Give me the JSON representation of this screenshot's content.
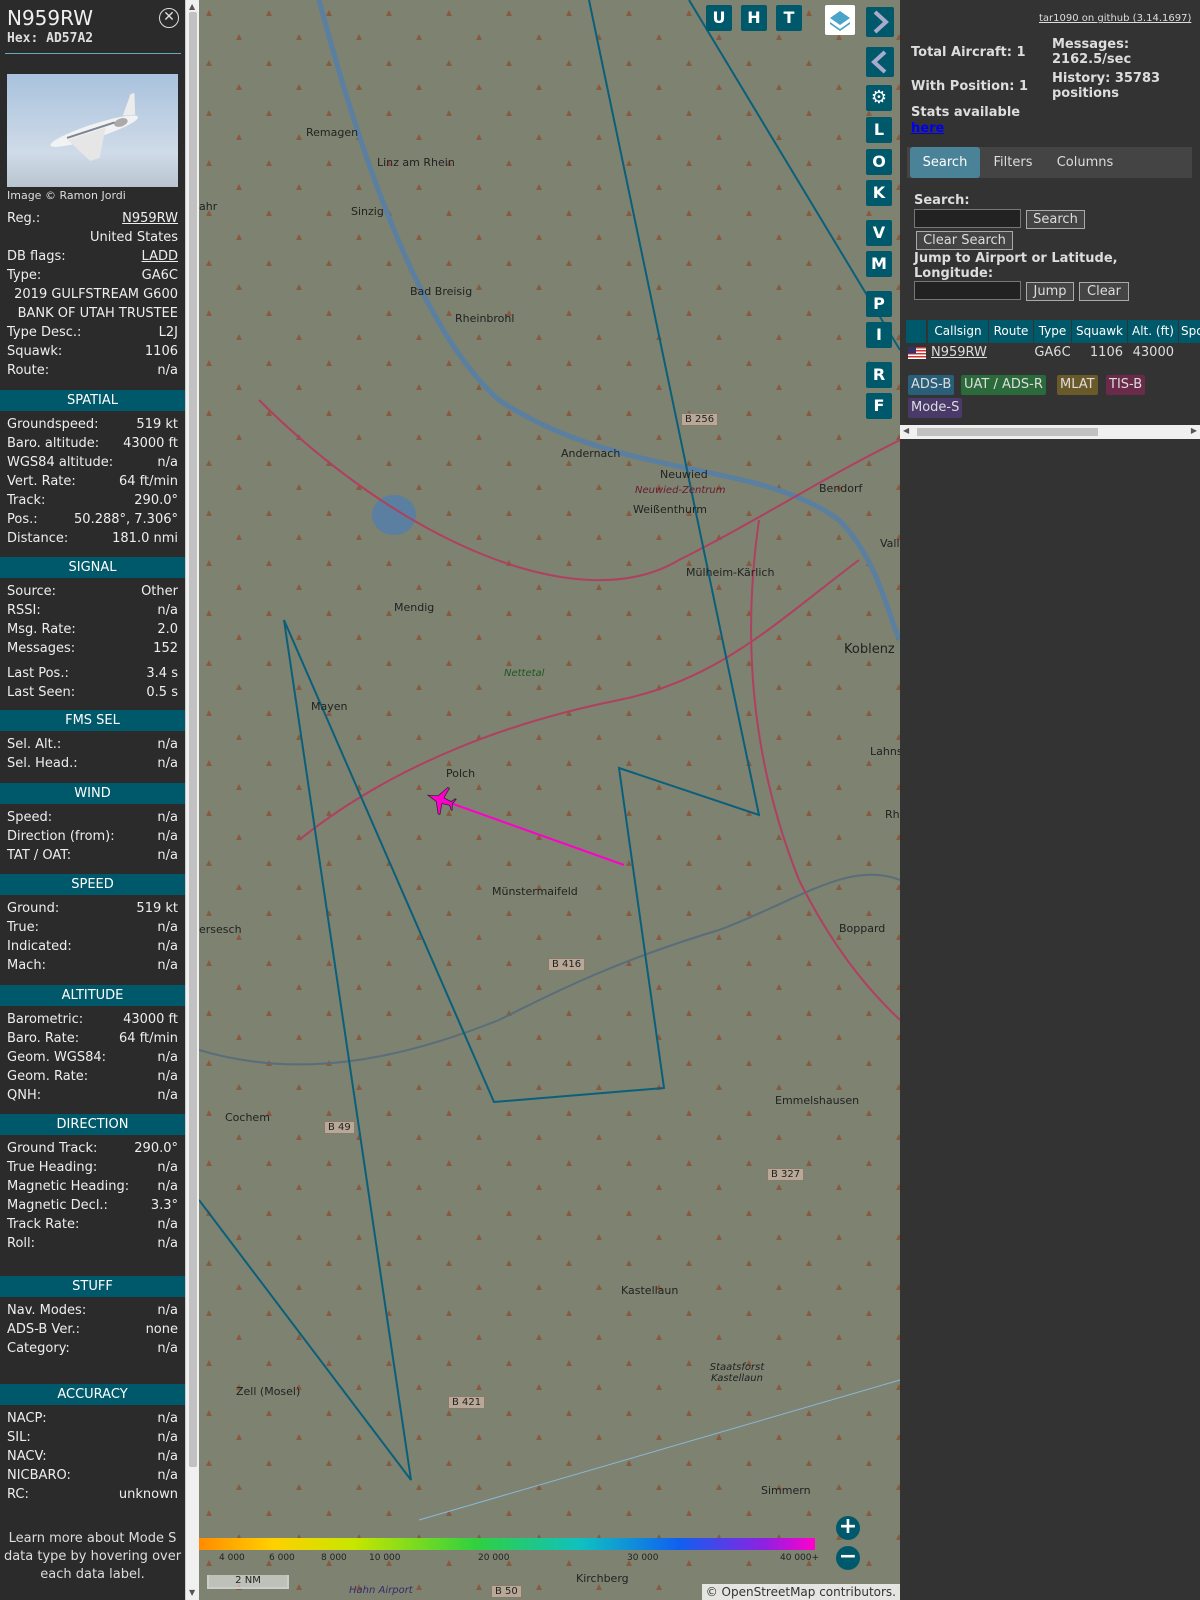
{
  "aircraft": {
    "registration": "N959RW",
    "hex_label": "Hex: AD57A2",
    "image_credit": "Image © Ramon Jordi",
    "details": [
      {
        "label": "Reg.:",
        "value": "N959RW"
      },
      {
        "label": "",
        "value": "United States"
      },
      {
        "label": "DB flags:",
        "value": "LADD"
      },
      {
        "label": "Type:",
        "value": "GA6C"
      },
      {
        "label": "",
        "value": "2019 GULFSTREAM G600"
      },
      {
        "label": "",
        "value": "BANK OF UTAH TRUSTEE"
      },
      {
        "label": "Type Desc.:",
        "value": "L2J"
      },
      {
        "label": "Squawk:",
        "value": "1106"
      },
      {
        "label": "Route:",
        "value": "n/a"
      }
    ],
    "sections": [
      {
        "title": "SPATIAL",
        "rows": [
          {
            "label": "Groundspeed:",
            "value": "519 kt"
          },
          {
            "label": "Baro. altitude:",
            "value": "43000 ft"
          },
          {
            "label": "WGS84 altitude:",
            "value": "n/a"
          },
          {
            "label": "Vert. Rate:",
            "value": "64 ft/min"
          },
          {
            "label": "Track:",
            "value": "290.0°"
          },
          {
            "label": "Pos.:",
            "value": "50.288°, 7.306°"
          },
          {
            "label": "Distance:",
            "value": "181.0 nmi"
          }
        ]
      },
      {
        "title": "SIGNAL",
        "rows": [
          {
            "label": "Source:",
            "value": "Other"
          },
          {
            "label": "RSSI:",
            "value": "n/a"
          },
          {
            "label": "Msg. Rate:",
            "value": "2.0"
          },
          {
            "label": "Messages:",
            "value": "152"
          },
          {
            "label": "Last Pos.:",
            "value": "3.4 s"
          },
          {
            "label": "Last Seen:",
            "value": "0.5 s"
          }
        ]
      },
      {
        "title": "FMS SEL",
        "rows": [
          {
            "label": "Sel. Alt.:",
            "value": "n/a"
          },
          {
            "label": "Sel. Head.:",
            "value": "n/a"
          }
        ]
      },
      {
        "title": "WIND",
        "rows": [
          {
            "label": "Speed:",
            "value": "n/a"
          },
          {
            "label": "Direction (from):",
            "value": "n/a"
          },
          {
            "label": "TAT / OAT:",
            "value": "n/a"
          }
        ]
      },
      {
        "title": "SPEED",
        "rows": [
          {
            "label": "Ground:",
            "value": "519 kt"
          },
          {
            "label": "True:",
            "value": "n/a"
          },
          {
            "label": "Indicated:",
            "value": "n/a"
          },
          {
            "label": "Mach:",
            "value": "n/a"
          }
        ]
      },
      {
        "title": "ALTITUDE",
        "rows": [
          {
            "label": "Barometric:",
            "value": "43000 ft"
          },
          {
            "label": "Baro. Rate:",
            "value": "64 ft/min"
          },
          {
            "label": "Geom. WGS84:",
            "value": "n/a"
          },
          {
            "label": "Geom. Rate:",
            "value": "n/a"
          },
          {
            "label": "QNH:",
            "value": "n/a"
          }
        ]
      },
      {
        "title": "DIRECTION",
        "rows": [
          {
            "label": "Ground Track:",
            "value": "290.0°"
          },
          {
            "label": "True Heading:",
            "value": "n/a"
          },
          {
            "label": "Magnetic Heading:",
            "value": "n/a"
          },
          {
            "label": "Magnetic Decl.:",
            "value": "3.3°"
          },
          {
            "label": "Track Rate:",
            "value": "n/a"
          },
          {
            "label": "Roll:",
            "value": "n/a"
          }
        ]
      },
      {
        "title": "STUFF",
        "rows": [
          {
            "label": "Nav. Modes:",
            "value": "n/a"
          },
          {
            "label": "ADS-B Ver.:",
            "value": "none"
          },
          {
            "label": "Category:",
            "value": "n/a"
          }
        ]
      },
      {
        "title": "ACCURACY",
        "rows": [
          {
            "label": "NACP:",
            "value": "n/a"
          },
          {
            "label": "SIL:",
            "value": "n/a"
          },
          {
            "label": "NACV:",
            "value": "n/a"
          },
          {
            "label": "NICBARO:",
            "value": "n/a"
          },
          {
            "label": "RC:",
            "value": "unknown"
          }
        ]
      }
    ],
    "learn_more": "Learn more about Mode S data type by hovering over each data label."
  },
  "map": {
    "toolbar_buttons": [
      "U",
      "H",
      "T"
    ],
    "side_buttons": [
      "L",
      "O",
      "K",
      "V",
      "M",
      "P",
      "I",
      "R",
      "F"
    ],
    "places": [
      "Remagen",
      "Linz am Rhein",
      "Sinzig",
      "Bad Breisig",
      "Rheinbrohl",
      "Andernach",
      "Neuwied",
      "Neuwied-Zentrum",
      "Weißenthurm",
      "Bendorf",
      "Mülheim-Kärlich",
      "Koblenz",
      "Mendig",
      "Nettetal",
      "Mayen",
      "Polch",
      "Münstermaifeld",
      "Boppard",
      "Emmelshausen",
      "Cochem",
      "Kastellaun",
      "Staatsforst Kastellaun",
      "Zell (Mosel)",
      "Simmern",
      "Kirchberg",
      "Hahn Airport",
      "B 256",
      "B 416",
      "B 49",
      "B 327",
      "B 421",
      "B 50",
      "Lahnste",
      "Valle",
      "Rh",
      "ersesch",
      "ahr"
    ],
    "scale_label": "2 NM",
    "attribution": "© OpenStreetMap contributors.",
    "altitude_legend": [
      "4 000",
      "6 000",
      "8 000",
      "10 000",
      "20 000",
      "30 000",
      "40 000+"
    ],
    "trail_color": "#ff00cc",
    "range_color": "#0a5f7a"
  },
  "right_panel": {
    "github_link": "tar1090 on github (3.14.1697)",
    "total_aircraft": "Total Aircraft: 1",
    "with_position": "With Position: 1",
    "messages": "Messages: 2162.5/sec",
    "history": "History: 35783 positions",
    "stats_text": "Stats available",
    "stats_link": "here",
    "tabs": [
      "Search",
      "Filters",
      "Columns"
    ],
    "search_label": "Search:",
    "search_button": "Search",
    "clear_search_button": "Clear Search",
    "jump_label": "Jump to Airport or Latitude, Longitude:",
    "jump_button": "Jump",
    "clear_button": "Clear",
    "table_headers": [
      "Callsign",
      "Route",
      "Type",
      "Squawk",
      "Alt. (ft)",
      "Spd"
    ],
    "table_row": {
      "callsign": "N959RW",
      "route": "",
      "type": "GA6C",
      "squawk": "1106",
      "altitude": "43000"
    },
    "badges": [
      "ADS-B",
      "UAT / ADS-R",
      "MLAT",
      "TIS-B",
      "Mode-S"
    ]
  }
}
